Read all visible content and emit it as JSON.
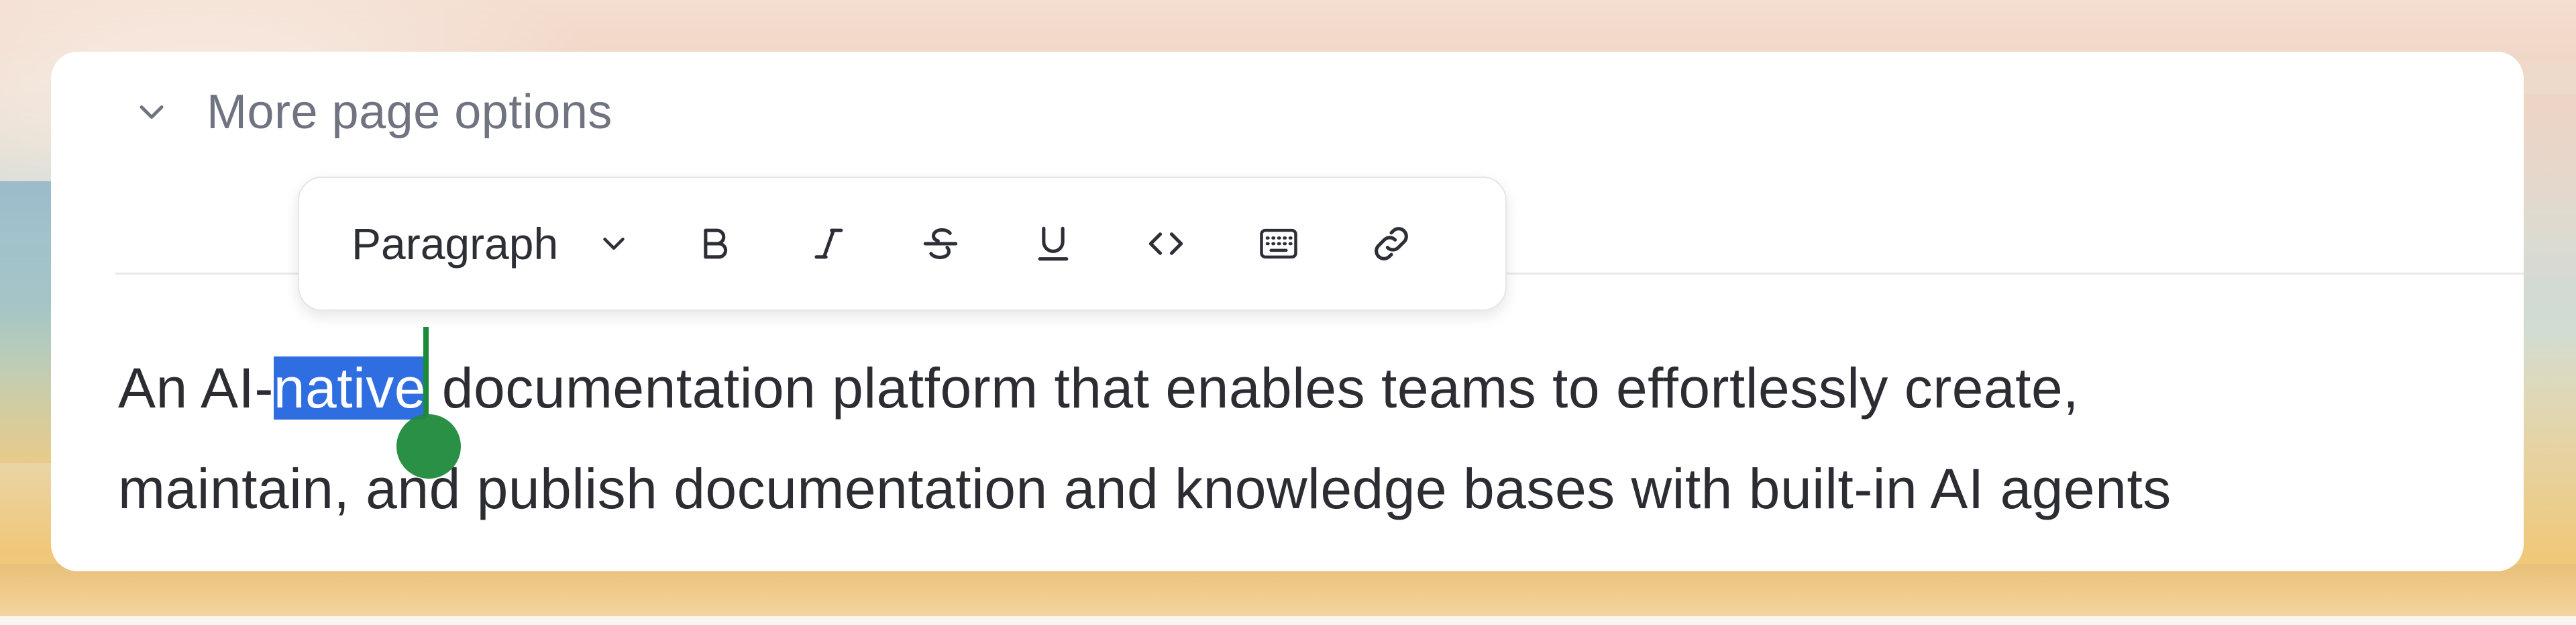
{
  "page": {
    "more_options_label": "More page options",
    "more_options_icon": "chevron-down-icon"
  },
  "toolbar": {
    "block_type_value": "Paragraph",
    "block_type_icon": "chevron-down-icon",
    "buttons": [
      {
        "name": "bold",
        "icon": "bold-icon"
      },
      {
        "name": "italic",
        "icon": "italic-icon"
      },
      {
        "name": "strikethrough",
        "icon": "strikethrough-icon"
      },
      {
        "name": "underline",
        "icon": "underline-icon"
      },
      {
        "name": "code",
        "icon": "code-icon"
      },
      {
        "name": "keyboard",
        "icon": "keyboard-icon"
      },
      {
        "name": "link",
        "icon": "link-icon"
      }
    ]
  },
  "content": {
    "line1_before": "An AI-",
    "selected_text": "native",
    "line1_after": " documentation platform that enables teams to effortlessly create,",
    "line2": "maintain, and publish documentation and knowledge bases with built-in AI agents"
  },
  "colors": {
    "selection": "#2f6ee0",
    "caret": "#1c8a3c"
  }
}
